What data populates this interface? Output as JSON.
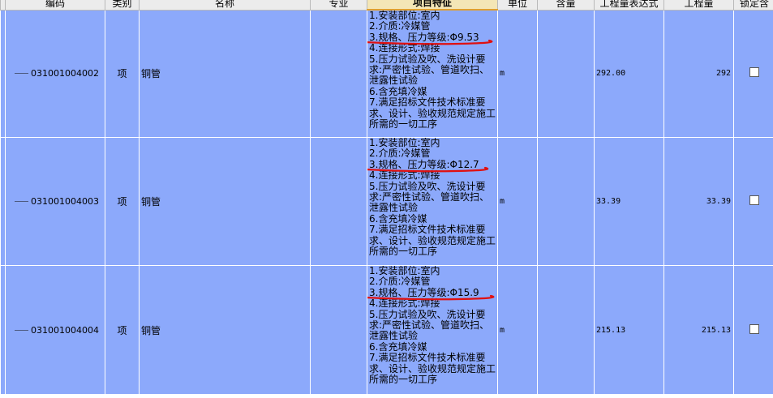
{
  "columns": {
    "code": "编码",
    "category": "类别",
    "name": "名称",
    "specialty": "专业",
    "feature": "项目特征",
    "unit": "单位",
    "content": "含量",
    "expression": "工程量表达式",
    "quantity": "工程量",
    "locked": "锁定含"
  },
  "rows": [
    {
      "code": "031001004002",
      "category": "项",
      "name": "铜管",
      "specialty": "",
      "feature_lines": [
        "1.安装部位:室内",
        "2.介质:冷媒管",
        "3.规格、压力等级:Φ9.53",
        "4.连接形式:焊接",
        "5.压力试验及吹、洗设计要",
        "求:严密性试验、管道吹扫、",
        "泄露性试验",
        "6.含充填冷媒",
        "7.满足招标文件技术标准要",
        "求、设计、验收规范规定施工",
        "所需的一切工序"
      ],
      "unit": "m",
      "content": "",
      "expression": "292.00",
      "quantity": "292",
      "locked": false
    },
    {
      "code": "031001004003",
      "category": "项",
      "name": "铜管",
      "specialty": "",
      "feature_lines": [
        "1.安装部位:室内",
        "2.介质:冷媒管",
        "3.规格、压力等级:Φ12.7",
        "4.连接形式:焊接",
        "5.压力试验及吹、洗设计要",
        "求:严密性试验、管道吹扫、",
        "泄露性试验",
        "6.含充填冷媒",
        "7.满足招标文件技术标准要",
        "求、设计、验收规范规定施工",
        "所需的一切工序"
      ],
      "unit": "m",
      "content": "",
      "expression": "33.39",
      "quantity": "33.39",
      "locked": false
    },
    {
      "code": "031001004004",
      "category": "项",
      "name": "铜管",
      "specialty": "",
      "feature_lines": [
        "1.安装部位:室内",
        "2.介质:冷媒管",
        "3.规格、压力等级:Φ15.9",
        "4.连接形式:焊接",
        "5.压力试验及吹、洗设计要",
        "求:严密性试验、管道吹扫、",
        "泄露性试验",
        "6.含充填冷媒",
        "7.满足招标文件技术标准要",
        "求、设计、验收规范规定施工",
        "所需的一切工序"
      ],
      "unit": "m",
      "content": "",
      "expression": "215.13",
      "quantity": "215.13",
      "locked": false
    }
  ],
  "colors": {
    "row_bg": "#8ca9fb",
    "header_bg": "#ececec",
    "feature_header_bg": "#f4e6b6",
    "annotation": "#e01010"
  }
}
